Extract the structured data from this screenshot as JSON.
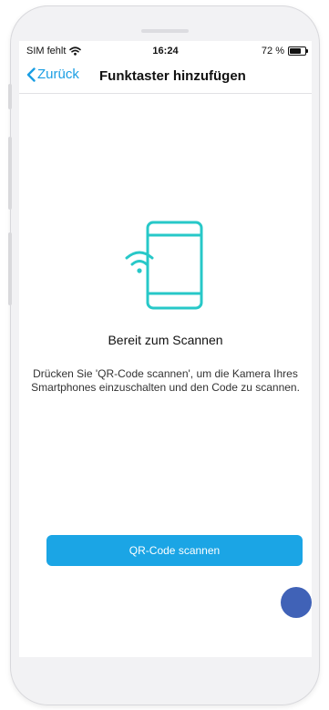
{
  "status_bar": {
    "carrier": "SIM fehlt",
    "time": "16:24",
    "battery_text": "72 %",
    "battery_level": 0.72
  },
  "nav": {
    "back_label": "Zurück",
    "title": "Funktaster hinzufügen"
  },
  "content": {
    "heading": "Bereit zum Scannen",
    "description": "Drücken Sie 'QR-Code scannen', um die Kamera Ihres Smartphones einzuschalten und den Code zu scannen."
  },
  "actions": {
    "scan_label": "QR-Code scannen"
  },
  "colors": {
    "accent": "#1ba5e5",
    "icon": "#27c8c8",
    "touch_indicator": "#1e46aa"
  },
  "icons": [
    "wifi-icon",
    "battery-icon",
    "chevron-left-icon",
    "phone-wireless-icon"
  ]
}
